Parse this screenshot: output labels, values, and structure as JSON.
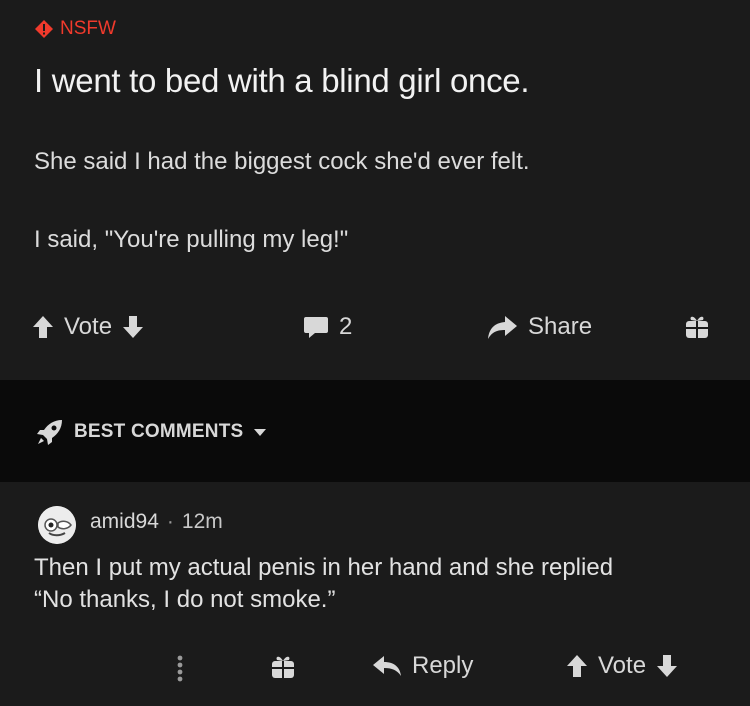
{
  "post": {
    "badge": "NSFW",
    "title": "I went to bed with a blind girl once.",
    "body_lines": [
      "She said I had the biggest cock she'd ever felt.",
      "I said, \"You're pulling my leg!\""
    ],
    "actions": {
      "vote_label": "Vote",
      "comment_count": "2",
      "share_label": "Share"
    }
  },
  "sort": {
    "label": "BEST COMMENTS"
  },
  "comment": {
    "username": "amid94",
    "separator": "·",
    "time": "12m",
    "text_lines": [
      "Then I put my actual penis in her hand and she replied",
      "“No thanks, I do not smoke.”"
    ],
    "actions": {
      "reply_label": "Reply",
      "vote_label": "Vote"
    }
  },
  "colors": {
    "nsfw": "#f03a2c",
    "background": "#1b1b1b",
    "band": "#0a0a0a",
    "text": "#e6e6e6"
  },
  "icons": [
    "nsfw-diamond-icon",
    "upvote-arrow-icon",
    "downvote-arrow-icon",
    "comment-bubble-icon",
    "share-arrow-icon",
    "gift-icon",
    "rocket-icon",
    "caret-down-icon",
    "more-vertical-icon",
    "reply-arrow-icon"
  ]
}
